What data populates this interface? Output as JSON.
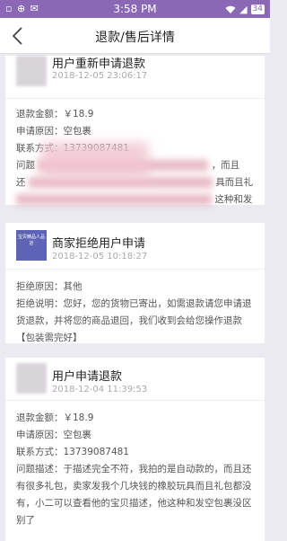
{
  "status": {
    "left_icons": "▫ ⊕ ✉",
    "time": "3:58 PM",
    "signal": "◢",
    "battery": "34"
  },
  "nav": {
    "title": "退款/售后详情"
  },
  "cards": [
    {
      "title": "用户重新申请退款",
      "time": "2018-12-05 23:06:17",
      "amount": "退款金额：￥18.9",
      "reason": "申请原因：空包裹",
      "contact": "联系方式：13739087481",
      "desc_start": "问题",
      "desc_frag1": "，而且",
      "desc_frag2": "还",
      "desc_frag3": "具而且礼",
      "desc_frag4": "这种和发"
    },
    {
      "shop_label": "宝贝精品人品店",
      "title": "商家拒绝用户申请",
      "time": "2018-12-05 10:18:27",
      "reason": "拒绝原因：其他",
      "explain": "拒绝说明：您好，您的货物已寄出，如需退款请您申请退货退款，并将您的商品退回，我们收到会给您操作退款【包装需完好】"
    },
    {
      "title": "用户申请退款",
      "time": "2018-12-04 11:39:53",
      "amount": "退款金额：￥18.9",
      "reason": "申请原因：空包裹",
      "contact": "联系方式：13739087481",
      "desc": "问题描述：于描述完全不符，我拍的是自动款的，而且还有很多礼包，卖家发我个几块钱的橡胶玩具而且礼包都没有，小二可以查看他的宝贝描述，他这种和发空包裹没区别了"
    }
  ]
}
